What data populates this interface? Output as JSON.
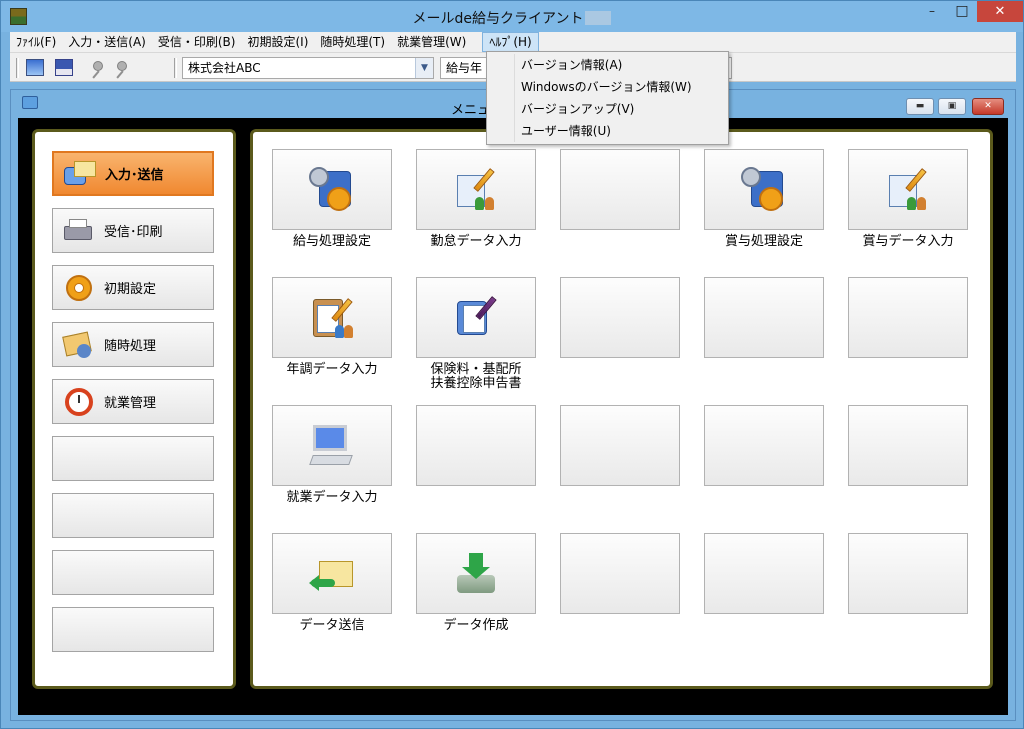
{
  "window": {
    "title": "メールde給与クライアント",
    "close_glyph": "✕",
    "min_glyph": "–",
    "max_glyph": "□"
  },
  "menubar": {
    "items": [
      "ﾌｧｲﾙ(F)",
      "入力・送信(A)",
      "受信・印刷(B)",
      "初期設定(I)",
      "随時処理(T)",
      "就業管理(W)",
      "ﾍﾙﾌﾟ(H)"
    ],
    "active": "ﾍﾙﾌﾟ(H)"
  },
  "toolbar": {
    "company_combo": "株式会社ABC",
    "period_combo": "給与年"
  },
  "help_menu": {
    "items": [
      "バージョン情報(A)",
      "Windowsのバージョン情報(W)",
      "バージョンアップ(V)",
      "ユーザー情報(U)"
    ]
  },
  "inner_window": {
    "title": "メニュー"
  },
  "nav": {
    "items": [
      "入力･送信",
      "受信･印刷",
      "初期設定",
      "随時処理",
      "就業管理",
      "",
      "",
      "",
      ""
    ],
    "selected": "入力･送信"
  },
  "tiles": {
    "row1": [
      "給与処理設定",
      "勤怠データ入力",
      "",
      "賞与処理設定",
      "賞与データ入力"
    ],
    "row2": [
      "年調データ入力",
      "保険料・基配所\n扶養控除申告書",
      "",
      "",
      ""
    ],
    "row3": [
      "就業データ入力",
      "",
      "",
      "",
      ""
    ],
    "row4": [
      "データ送信",
      "データ作成",
      "",
      "",
      ""
    ]
  },
  "colors": {
    "title_bar": "#7eb8e6",
    "selected_nav": "#f08830",
    "panel_border": "#5b5a1c",
    "close_red": "#c7463c"
  }
}
